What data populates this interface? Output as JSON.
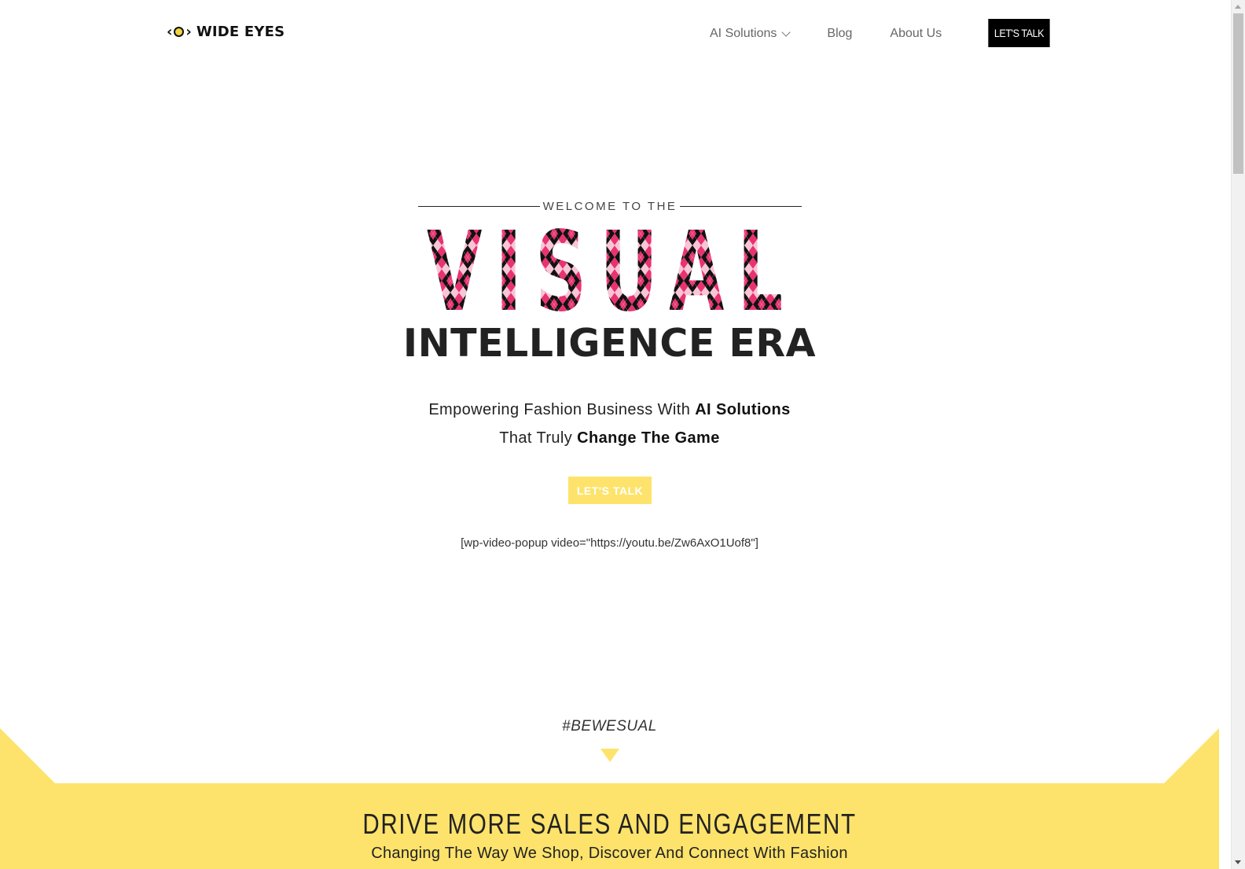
{
  "header": {
    "logo_mark": "<o>",
    "logo_text": "WIDE EYES",
    "nav": [
      {
        "label": "AI Solutions",
        "has_dropdown": true
      },
      {
        "label": "Blog",
        "has_dropdown": false
      },
      {
        "label": "About Us",
        "has_dropdown": false
      }
    ],
    "cta_label": "LET'S TALK"
  },
  "hero": {
    "welcome": "WELCOME TO THE",
    "visual_word": "VISUAL",
    "headline": "INTELLIGENCE ERA",
    "tagline_line1_regular": "Empowering Fashion Business With ",
    "tagline_line1_bold": "AI Solutions",
    "tagline_line2_regular": "That Truly ",
    "tagline_line2_bold": "Change The Game",
    "cta_label": "LET'S TALK",
    "shortcode": "[wp-video-popup video=\"https://youtu.be/Zw6AxO1Uof8\"]"
  },
  "section": {
    "hashtag": "#BEWESUAL",
    "title": "DRIVE MORE SALES AND ENGAGEMENT",
    "subtitle": "Changing The Way We Shop, Discover And Connect With Fashion"
  },
  "colors": {
    "accent_yellow": "#fde36b",
    "argyle_pink": "#e8336f",
    "argyle_light_pink": "#f8c5d6",
    "argyle_black": "#111111",
    "cta_black": "#000000"
  }
}
